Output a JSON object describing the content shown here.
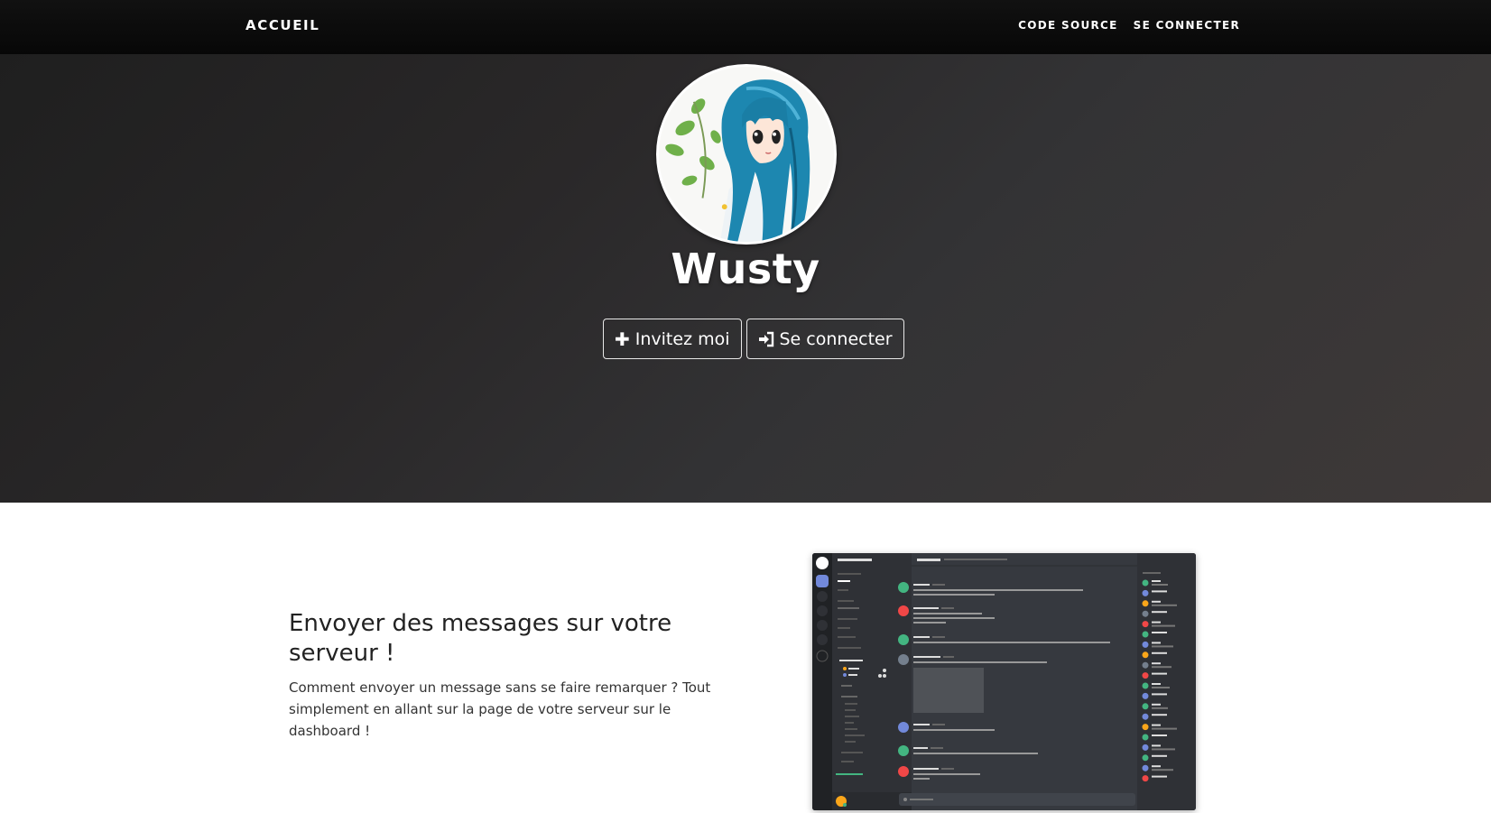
{
  "navbar": {
    "brand": "ACCUEIL",
    "links": [
      "CODE SOURCE",
      "SE CONNECTER"
    ]
  },
  "hero": {
    "bot_name": "Wusty",
    "buttons": [
      {
        "icon": "plus-icon",
        "label": "Invitez moi"
      },
      {
        "icon": "sign-in-icon",
        "label": "Se connecter"
      }
    ]
  },
  "feature": {
    "title": "Envoyer des messages sur votre serveur !",
    "description": "Comment envoyer un message sans se faire remarquer ? Tout simplement en allant sur la page de votre serveur sur le dashboard !"
  },
  "colors": {
    "navbar": "#0b0b0b",
    "hero_start": "#1f1f1f",
    "hero_end": "#3e3938",
    "discord_bg": "#36393f",
    "discord_sidebar": "#2f3136",
    "discord_servers": "#202225",
    "blurple": "#7289da"
  }
}
